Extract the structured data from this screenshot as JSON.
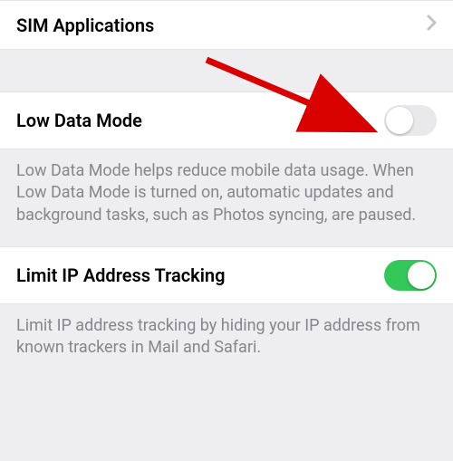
{
  "rows": {
    "sim_applications": {
      "label": "SIM Applications"
    },
    "low_data_mode": {
      "label": "Low Data Mode",
      "on": false,
      "footer": "Low Data Mode helps reduce mobile data usage. When Low Data Mode is turned on, automatic updates and background tasks, such as Photos syncing, are paused."
    },
    "limit_ip_tracking": {
      "label": "Limit IP Address Tracking",
      "on": true,
      "footer": "Limit IP address tracking by hiding your IP address from known trackers in Mail and Safari."
    }
  },
  "colors": {
    "toggle_on": "#34c759",
    "toggle_off": "#e9e9eb"
  }
}
